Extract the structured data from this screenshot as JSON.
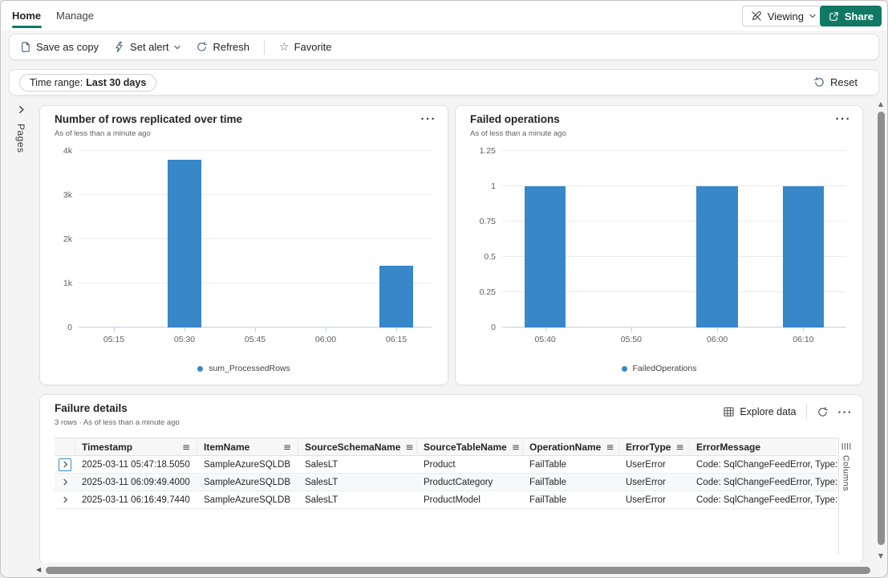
{
  "tabs": {
    "home": "Home",
    "manage": "Manage"
  },
  "topbar": {
    "viewing_label": "Viewing",
    "share_label": "Share"
  },
  "toolbar": {
    "save_as_copy": "Save as copy",
    "set_alert": "Set alert",
    "refresh": "Refresh",
    "favorite": "Favorite"
  },
  "filterbar": {
    "time_range_label": "Time range:",
    "time_range_value": "Last 30 days",
    "reset_label": "Reset"
  },
  "pages_panel": {
    "label": "Pages"
  },
  "columns_panel": {
    "label": "Columns"
  },
  "icons": {
    "more": "···",
    "column_menu": "≡",
    "star": "☆",
    "scroll_up": "▲",
    "scroll_down": "▼",
    "scroll_left": "◀"
  },
  "colors": {
    "accent_teal": "#117865",
    "bar_blue": "#3787C9"
  },
  "chart_data": [
    {
      "type": "bar",
      "title": "Number of rows replicated over time",
      "subtitle": "As of less than a minute ago",
      "categories": [
        "05:15",
        "05:30",
        "05:45",
        "06:00",
        "06:15"
      ],
      "series": [
        {
          "name": "sum_ProcessedRows",
          "values": [
            0,
            3800,
            0,
            0,
            1400
          ]
        }
      ],
      "ylim": [
        0,
        4000
      ],
      "yticks": [
        {
          "label": "0",
          "value": 0
        },
        {
          "label": "1k",
          "value": 1000
        },
        {
          "label": "2k",
          "value": 2000
        },
        {
          "label": "3k",
          "value": 3000
        },
        {
          "label": "4k",
          "value": 4000
        }
      ],
      "grid": true,
      "legend_position": "bottom",
      "bar_color": "#3787C9"
    },
    {
      "type": "bar",
      "title": "Failed operations",
      "subtitle": "As of less than a minute ago",
      "categories": [
        "05:40",
        "05:50",
        "06:00",
        "06:10"
      ],
      "series": [
        {
          "name": "FailedOperations",
          "values": [
            1,
            0,
            1,
            1
          ]
        }
      ],
      "ylim": [
        0,
        1.25
      ],
      "yticks": [
        {
          "label": "0",
          "value": 0
        },
        {
          "label": "0.25",
          "value": 0.25
        },
        {
          "label": "0.5",
          "value": 0.5
        },
        {
          "label": "0.75",
          "value": 0.75
        },
        {
          "label": "1",
          "value": 1
        },
        {
          "label": "1.25",
          "value": 1.25
        }
      ],
      "grid": true,
      "legend_position": "bottom",
      "bar_color": "#3787C9"
    }
  ],
  "failure_details": {
    "title": "Failure details",
    "subtitle": "3 rows · As of less than a minute ago",
    "explore_data_label": "Explore data",
    "columns": [
      "Timestamp",
      "ItemName",
      "SourceSchemaName",
      "SourceTableName",
      "OperationName",
      "ErrorType",
      "ErrorMessage"
    ],
    "rows": [
      [
        "2025-03-11 05:47:18.5050",
        "SampleAzureSQLDB",
        "SalesLT",
        "Product",
        "FailTable",
        "UserError",
        "Code: SqlChangeFeedError, Type:"
      ],
      [
        "2025-03-11 06:09:49.4000",
        "SampleAzureSQLDB",
        "SalesLT",
        "ProductCategory",
        "FailTable",
        "UserError",
        "Code: SqlChangeFeedError, Type:"
      ],
      [
        "2025-03-11 06:16:49.7440",
        "SampleAzureSQLDB",
        "SalesLT",
        "ProductModel",
        "FailTable",
        "UserError",
        "Code: SqlChangeFeedError, Type:"
      ]
    ]
  }
}
